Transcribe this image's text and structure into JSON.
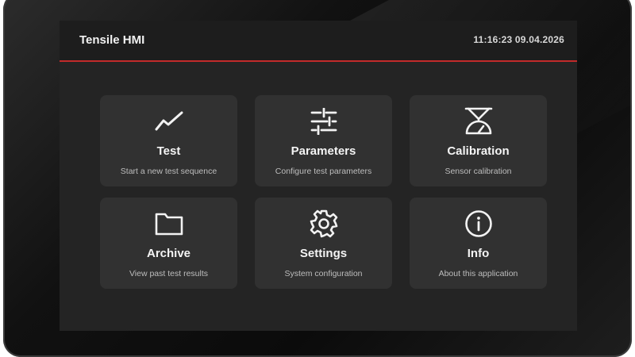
{
  "header": {
    "title": "Tensile HMI",
    "datetime": "11:16:23 09.04.2026",
    "accent_color": "#c22a2a"
  },
  "tiles": [
    {
      "label": "Test",
      "description": "Start a new test sequence",
      "icon": "chart-line-icon"
    },
    {
      "label": "Parameters",
      "description": "Configure test parameters",
      "icon": "sliders-icon"
    },
    {
      "label": "Calibration",
      "description": "Sensor calibration",
      "icon": "scale-gauge-icon"
    },
    {
      "label": "Archive",
      "description": "View past test results",
      "icon": "folder-icon"
    },
    {
      "label": "Settings",
      "description": "System configuration",
      "icon": "gear-icon"
    },
    {
      "label": "Info",
      "description": "About this application",
      "icon": "info-icon"
    }
  ]
}
